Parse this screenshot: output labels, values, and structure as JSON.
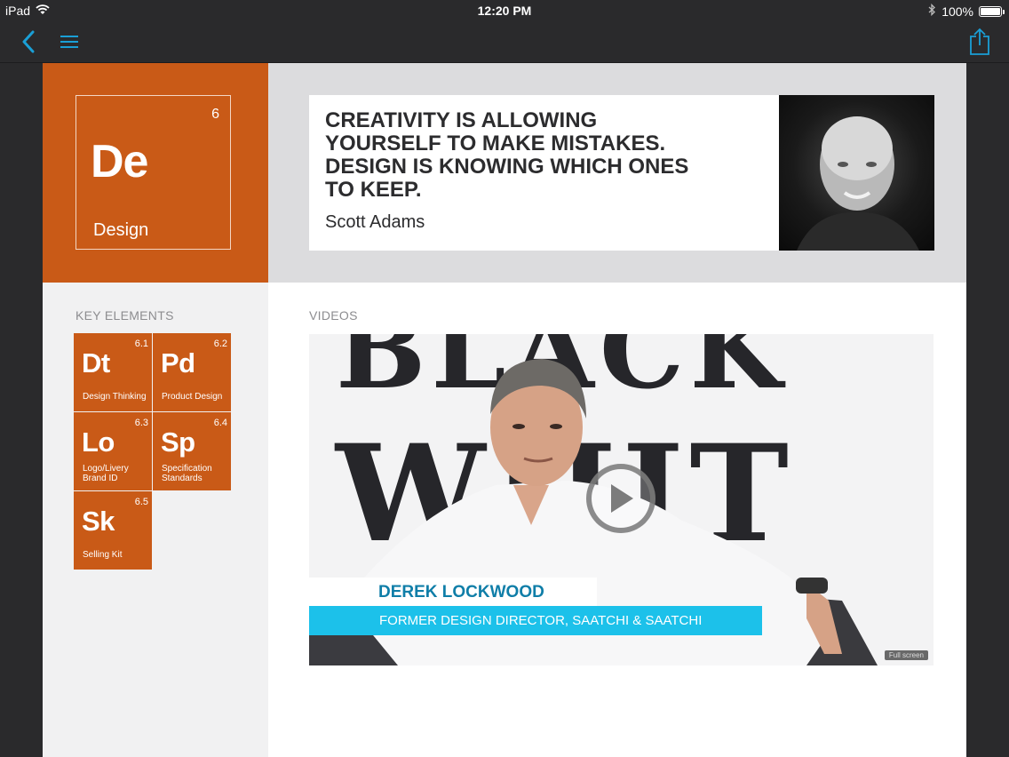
{
  "status_bar": {
    "device": "iPad",
    "time": "12:20 PM",
    "battery": "100%",
    "battery_fraction": 1.0
  },
  "nav": {
    "back_icon": "chevron-left-icon",
    "menu_icon": "hamburger-icon",
    "share_icon": "share-icon",
    "accent": "#1a9fd6"
  },
  "element": {
    "number": "6",
    "symbol": "De",
    "name": "Design",
    "color": "#c95a17"
  },
  "quote": {
    "text": "CREATIVITY IS ALLOWING YOURSELF TO MAKE MISTAKES. DESIGN IS KNOWING WHICH ONES TO KEEP.",
    "author": "Scott Adams"
  },
  "key_elements": {
    "label": "KEY ELEMENTS",
    "items": [
      {
        "number": "6.1",
        "symbol": "Dt",
        "name": "Design Thinking"
      },
      {
        "number": "6.2",
        "symbol": "Pd",
        "name": "Product Design"
      },
      {
        "number": "6.3",
        "symbol": "Lo",
        "name": "Logo/Livery Brand ID"
      },
      {
        "number": "6.4",
        "symbol": "Sp",
        "name": "Specification Standards"
      },
      {
        "number": "6.5",
        "symbol": "Sk",
        "name": "Selling Kit"
      }
    ]
  },
  "videos": {
    "label": "VIDEOS",
    "bg_word_top": "BLACK",
    "bg_word_bottom": "WHIT",
    "speaker_name": "DEREK LOCKWOOD",
    "speaker_title": "FORMER DESIGN DIRECTOR, SAATCHI & SAATCHI",
    "fullscreen_label": "Full screen",
    "lower_third_color": "#1cc1ea"
  }
}
